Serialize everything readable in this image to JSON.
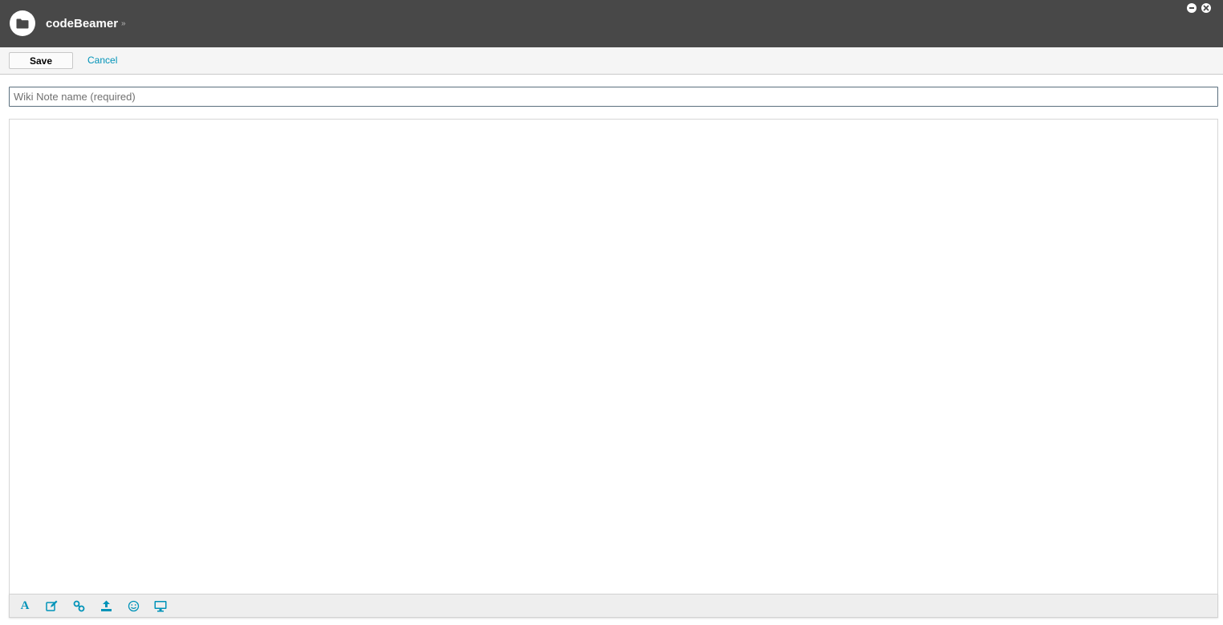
{
  "window": {
    "title": "codeBeamer",
    "title_arrow": "»",
    "icon": "folder-icon",
    "controls": [
      "minimize-icon",
      "close-icon"
    ]
  },
  "toolbar": {
    "save_label": "Save",
    "cancel_label": "Cancel"
  },
  "form": {
    "name_placeholder": "Wiki Note name (required)",
    "name_value": "",
    "body_value": ""
  },
  "editor_toolbar": {
    "tools": [
      {
        "name": "text-formatting-icon",
        "glyph": "A"
      },
      {
        "name": "edit-icon"
      },
      {
        "name": "link-icon"
      },
      {
        "name": "upload-icon"
      },
      {
        "name": "emoticon-icon"
      },
      {
        "name": "preview-monitor-icon"
      }
    ]
  },
  "colors": {
    "title_bar": "#484848",
    "accent": "#0093b8",
    "toolbar_bg": "#f5f5f5"
  }
}
